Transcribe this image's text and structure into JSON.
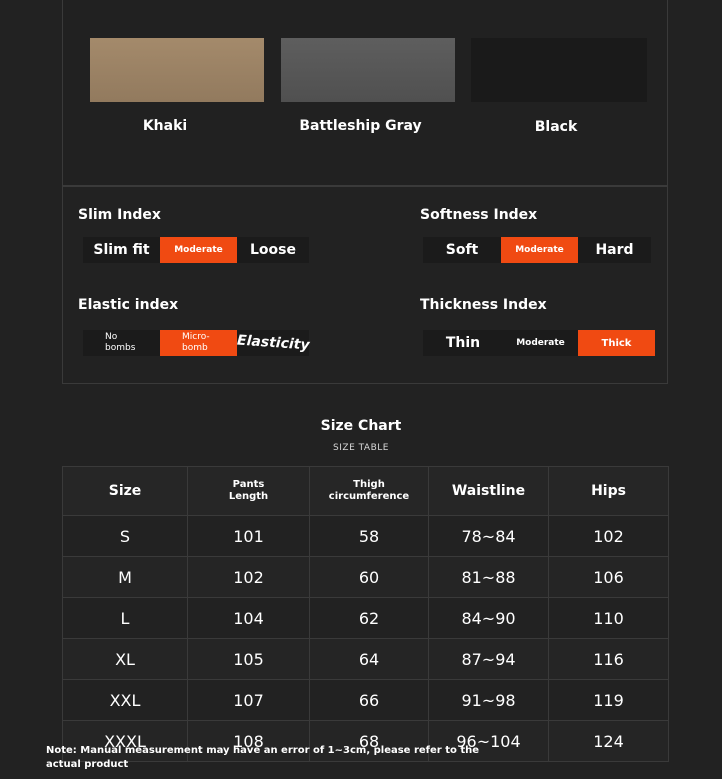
{
  "colors": {
    "options": [
      {
        "name": "Khaki",
        "hex": "#9f866a"
      },
      {
        "name": "Battleship Gray",
        "hex": "#575757"
      },
      {
        "name": "Black",
        "hex": "#1a1a1a"
      }
    ]
  },
  "indices": {
    "slim": {
      "title": "Slim Index",
      "options": [
        "Slim fit",
        "Moderate",
        "Loose"
      ],
      "selected": "Moderate"
    },
    "softness": {
      "title": "Softness Index",
      "options": [
        "Soft",
        "Moderate",
        "Hard"
      ],
      "selected": "Moderate"
    },
    "elastic": {
      "title": "Elastic index",
      "options": [
        "No bombs",
        "Micro-bomb",
        "Elasticity"
      ],
      "option_lines": {
        "no_bombs": [
          "No",
          "bombs"
        ],
        "micro_bomb": [
          "Micro-",
          "bomb"
        ]
      },
      "selected": "Micro-bomb"
    },
    "thickness": {
      "title": "Thickness Index",
      "options": [
        "Thin",
        "Moderate",
        "Thick"
      ],
      "selected": "Thick"
    },
    "accent_color": "#f04a12"
  },
  "size_chart": {
    "title": "Size Chart",
    "subtitle": "SIZE TABLE",
    "headers": [
      "Size",
      "Pants Length",
      "Thigh circumference",
      "Waistline",
      "Hips"
    ],
    "header_lines": {
      "pants": [
        "Pants",
        "Length"
      ],
      "thigh": [
        "Thigh",
        "circumference"
      ]
    },
    "rows": [
      [
        "S",
        "101",
        "58",
        "78~84",
        "102"
      ],
      [
        "M",
        "102",
        "60",
        "81~88",
        "106"
      ],
      [
        "L",
        "104",
        "62",
        "84~90",
        "110"
      ],
      [
        "XL",
        "105",
        "64",
        "87~94",
        "116"
      ],
      [
        "XXL",
        "107",
        "66",
        "91~98",
        "119"
      ],
      [
        "XXXL",
        "108",
        "68",
        "96~104",
        "124"
      ]
    ]
  },
  "note": {
    "lines": [
      "Note: Manual measurement may have an error of 1~3cm, please refer to the",
      "actual product"
    ]
  }
}
